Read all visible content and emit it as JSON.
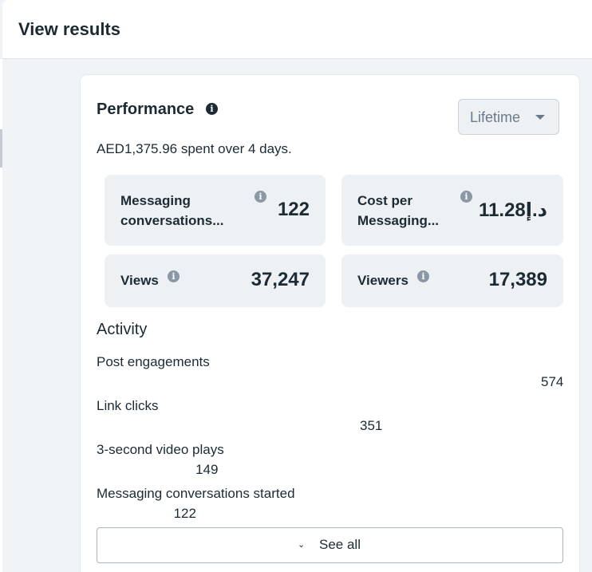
{
  "header": {
    "title": "View results"
  },
  "performance": {
    "title": "Performance",
    "info_icon": "info-icon",
    "range": {
      "selected": "Lifetime"
    },
    "spent_text": "AED1,375.96 spent over 4 days.",
    "metrics": [
      {
        "label_line1": "Messaging",
        "label_line2": "conversations...",
        "value": "122"
      },
      {
        "label_line1": "Cost per",
        "label_line2": "Messaging...",
        "value": "11.28د.إ"
      },
      {
        "label": "Views",
        "value": "37,247"
      },
      {
        "label": "Viewers",
        "value": "17,389"
      }
    ]
  },
  "activity": {
    "title": "Activity",
    "items": [
      {
        "label": "Post engagements",
        "value": "574",
        "fraction": 1.0
      },
      {
        "label": "Link clicks",
        "value": "351",
        "fraction": 0.612
      },
      {
        "label": "3-second video plays",
        "value": "149",
        "fraction": 0.26
      },
      {
        "label": "Messaging conversations started",
        "value": "122",
        "fraction": 0.213
      }
    ],
    "see_all_label": "See all"
  }
}
